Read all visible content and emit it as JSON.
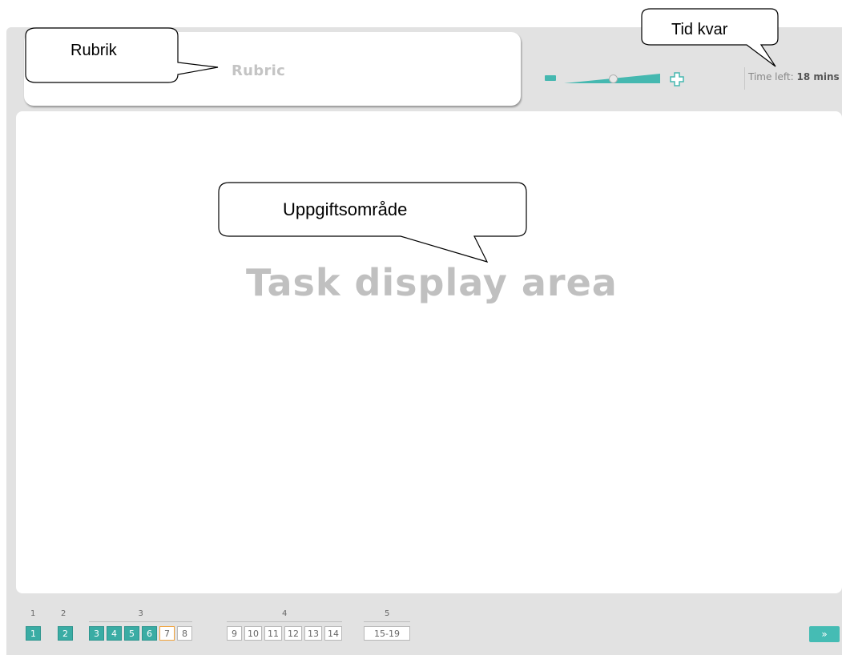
{
  "rubric": {
    "text": "Rubric"
  },
  "zoom": {
    "level": 0.5
  },
  "timer": {
    "label": "Time left:",
    "value": "18 mins"
  },
  "task_area": {
    "placeholder": "Task display area"
  },
  "annotations": {
    "rubric_callout": "Rubrik",
    "timer_callout": "Tid kvar",
    "task_callout": "Uppgiftsområde"
  },
  "navigation": {
    "sections": [
      {
        "label": "1",
        "items": [
          {
            "label": "1",
            "state": "done"
          }
        ]
      },
      {
        "label": "2",
        "items": [
          {
            "label": "2",
            "state": "done"
          }
        ]
      },
      {
        "label": "3",
        "items": [
          {
            "label": "3",
            "state": "done"
          },
          {
            "label": "4",
            "state": "done"
          },
          {
            "label": "5",
            "state": "done"
          },
          {
            "label": "6",
            "state": "done"
          },
          {
            "label": "7",
            "state": "current"
          },
          {
            "label": "8",
            "state": "todo"
          }
        ]
      },
      {
        "label": "4",
        "items": [
          {
            "label": "9",
            "state": "todo"
          },
          {
            "label": "10",
            "state": "todo"
          },
          {
            "label": "11",
            "state": "todo"
          },
          {
            "label": "12",
            "state": "todo"
          },
          {
            "label": "13",
            "state": "todo"
          },
          {
            "label": "14",
            "state": "todo"
          }
        ]
      },
      {
        "label": "5",
        "items": [
          {
            "label": "15-19",
            "state": "todo"
          }
        ]
      }
    ],
    "next_label": "»",
    "colors": {
      "done": "#3aaca4",
      "current_border": "#f0a23a",
      "todo_border": "#b8b8b8"
    }
  }
}
